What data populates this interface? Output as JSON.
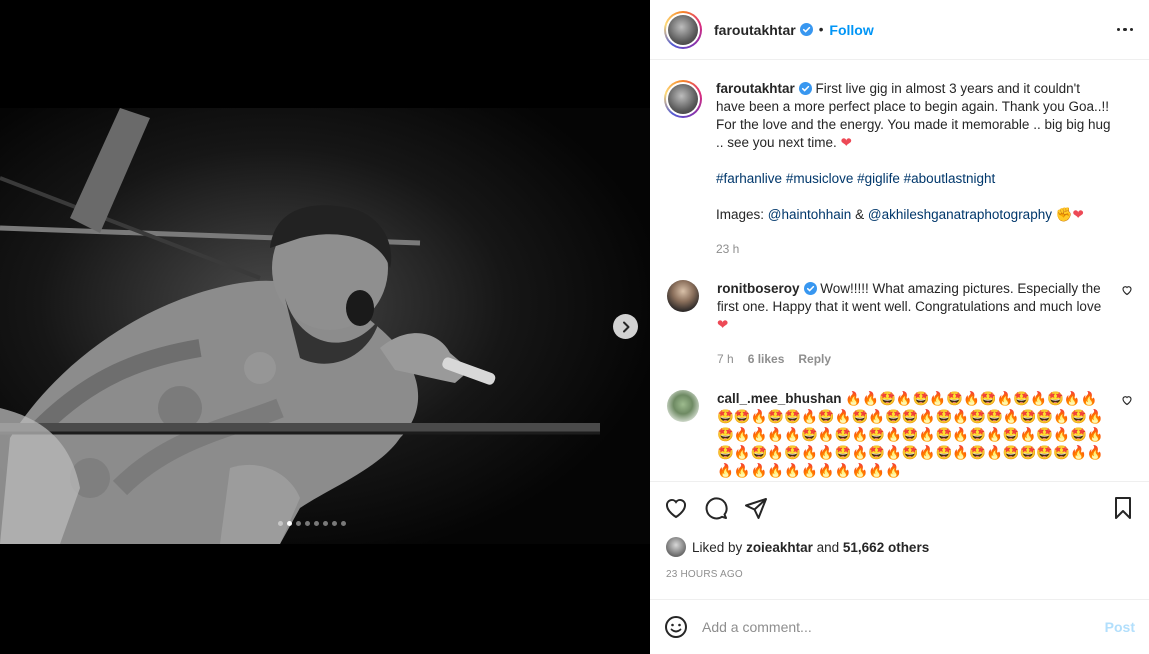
{
  "media": {
    "carousel_total": 8,
    "carousel_active": 2
  },
  "header": {
    "username": "faroutakhtar",
    "separator": "•",
    "follow_label": "Follow"
  },
  "caption": {
    "username": "faroutakhtar",
    "text": "First live gig in almost 3 years and it couldn't have been a more perfect place to begin again. Thank you Goa..!! For the love and the energy. You made it memorable .. big big hug .. see you next time.",
    "heart": "❤",
    "hashtags": [
      "#farhanlive",
      "#musiclove",
      "#giglife",
      "#aboutlastnight"
    ],
    "images_label": "Images:",
    "credit_1": "@haintohhain",
    "amp": "&",
    "credit_2": "@akhileshganatraphotography",
    "credit_emoji": "✊",
    "credit_heart": "❤",
    "age": "23 h"
  },
  "comments": [
    {
      "username": "ronitboseroy",
      "verified": true,
      "text": "Wow!!!!! What amazing pictures. Especially the first one. Happy that it went well. Congratulations and much love",
      "emoji": "❤",
      "age": "7 h",
      "likes": "6 likes",
      "reply_label": "Reply"
    },
    {
      "username": "call_.mee_bhushan",
      "verified": false,
      "text": "🔥🔥🤩🔥🤩🔥🤩🔥🤩🔥🤩🔥🤩🔥🔥🤩🤩🔥🤩🤩🔥🤩🔥🤩🔥🤩🤩🔥🤩🔥🤩🤩🔥🤩🤩🔥🤩🔥🤩🔥🔥🔥🔥🤩🔥🤩🔥🤩🔥🤩🔥🤩🔥🤩🔥🤩🔥🤩🔥🤩🔥🤩🔥🤩🔥🤩🔥🔥🤩🔥🤩🔥🤩🔥🤩🔥🤩🔥🤩🤩🤩🤩🔥🔥🔥🔥🔥🔥🔥🔥🔥🔥🔥🔥🔥"
    }
  ],
  "likes": {
    "liked_by_label": "Liked by",
    "user": "zoieakhtar",
    "and_label": "and",
    "count": "51,662 others"
  },
  "timestamp": "23 HOURS AGO",
  "add_comment": {
    "placeholder": "Add a comment...",
    "post_label": "Post"
  },
  "colors": {
    "link": "#00376b",
    "follow": "#0095f6",
    "post_disabled": "#b2dffc",
    "verified": "#3897f0",
    "heart": "#ed4956"
  }
}
